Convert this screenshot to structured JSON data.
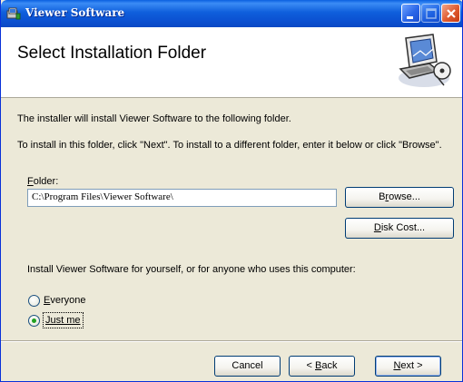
{
  "window": {
    "title": "Viewer Software",
    "minimize_icon": "minimize-icon",
    "maximize_icon": "maximize-icon",
    "close_icon": "close-icon",
    "app_icon": "installer-icon"
  },
  "header": {
    "title": "Select Installation Folder",
    "art_icon": "computer-setup-icon"
  },
  "body": {
    "line1": "The installer will install Viewer Software to the following folder.",
    "line2": "To install in this folder, click \"Next\". To install to a different folder, enter it below or click \"Browse\"."
  },
  "folder": {
    "label_hotkey": "F",
    "label_rest": "older:",
    "value": "C:\\Program Files\\Viewer Software\\"
  },
  "buttons": {
    "browse_hotkey": "r",
    "browse_pre": "B",
    "browse_post": "owse...",
    "diskcost_hotkey": "D",
    "diskcost_rest": "isk Cost...",
    "cancel": "Cancel",
    "back_pre": "< ",
    "back_hotkey": "B",
    "back_post": "ack",
    "next_hotkey": "N",
    "next_post": "ext >"
  },
  "install_for": {
    "prompt": "Install Viewer Software for yourself, or for anyone who uses this computer:",
    "options": [
      {
        "hotkey": "E",
        "rest": "veryone",
        "selected": false
      },
      {
        "hotkey": "J",
        "rest_underlined": "ust me",
        "selected": true
      }
    ]
  },
  "colors": {
    "titlebar": "#0b4fd0",
    "dialog_bg": "#ece9d8",
    "radio_selected": "#21a121"
  }
}
